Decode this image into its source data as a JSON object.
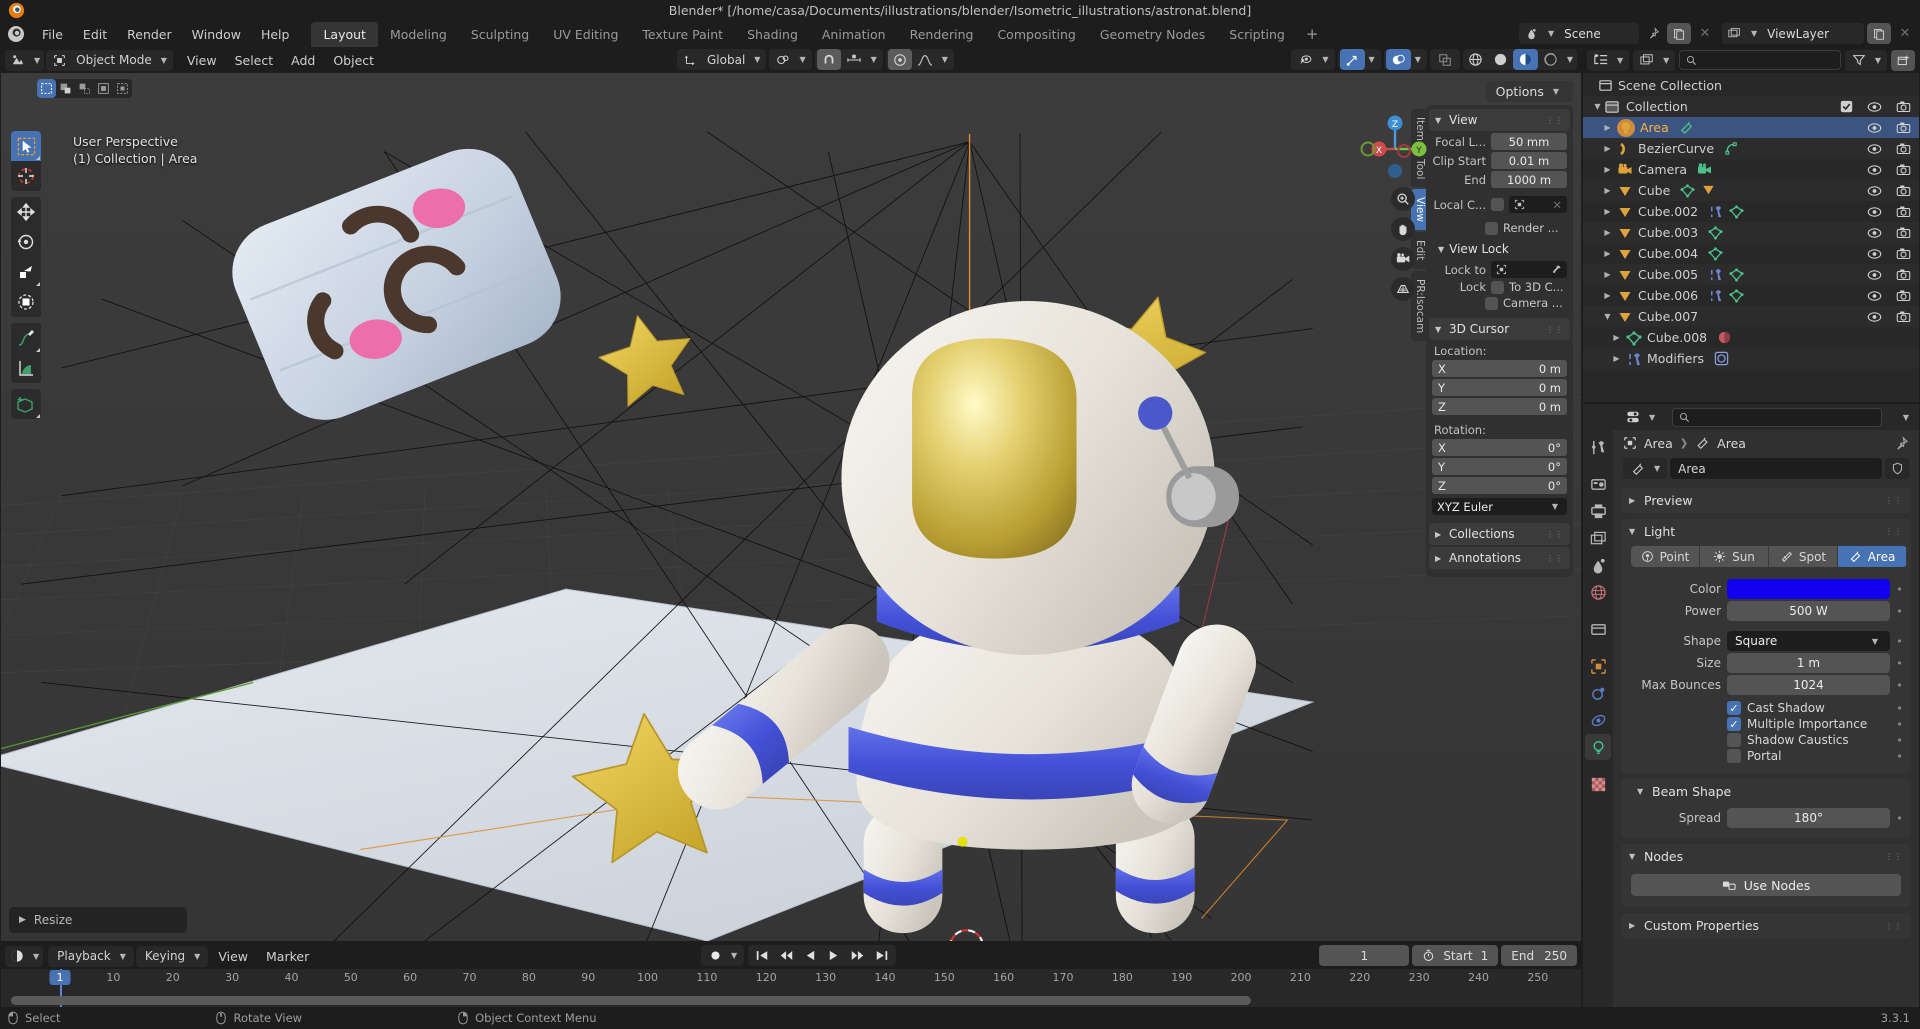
{
  "window": {
    "title": "Blender* [/home/casa/Documents/illustrations/blender/Isometric_illustrations/astronat.blend]"
  },
  "menubar": {
    "items": [
      "File",
      "Edit",
      "Render",
      "Window",
      "Help"
    ],
    "workspaces": [
      "Layout",
      "Modeling",
      "Sculpting",
      "UV Editing",
      "Texture Paint",
      "Shading",
      "Animation",
      "Rendering",
      "Compositing",
      "Geometry Nodes",
      "Scripting"
    ],
    "active_workspace": "Layout",
    "add_workspace": "+",
    "scene_name": "Scene",
    "viewlayer_name": "ViewLayer"
  },
  "viewport": {
    "mode": "Object Mode",
    "menus": [
      "View",
      "Select",
      "Add",
      "Object"
    ],
    "transform_orientation": "Global",
    "overlay_text_line1": "User Perspective",
    "overlay_text_line2": "(1) Collection | Area",
    "options_label": "Options",
    "operator_panel": "Resize",
    "gizmo_axes": {
      "x": "X",
      "y": "Y",
      "z": "Z"
    },
    "tools": [
      "tweak-select-tool",
      "cursor-tool",
      "move-tool",
      "rotate-tool",
      "scale-tool",
      "transform-tool",
      "annotate-tool",
      "measure-tool",
      "add-cube-tool"
    ]
  },
  "npanel": {
    "tabs": [
      "Item",
      "Tool",
      "View",
      "Edit",
      "PR:Isocam"
    ],
    "active_tab": "View",
    "view": {
      "title": "View",
      "rows": [
        {
          "label": "Focal L...",
          "value": "50 mm"
        },
        {
          "label": "Clip Start",
          "value": "0.01 m"
        },
        {
          "label": "End",
          "value": "1000 m"
        }
      ],
      "local_camera_label": "Local C...",
      "render_label": "Render ...",
      "view_lock_title": "View Lock",
      "lock_to_label": "Lock to",
      "lock_label": "Lock",
      "to_3d_cursor_label": "To 3D C...",
      "camera_label": "Camera ..."
    },
    "cursor": {
      "title": "3D Cursor",
      "location_label": "Location:",
      "location": [
        {
          "axis": "X",
          "value": "0 m"
        },
        {
          "axis": "Y",
          "value": "0 m"
        },
        {
          "axis": "Z",
          "value": "0 m"
        }
      ],
      "rotation_label": "Rotation:",
      "rotation": [
        {
          "axis": "X",
          "value": "0°"
        },
        {
          "axis": "Y",
          "value": "0°"
        },
        {
          "axis": "Z",
          "value": "0°"
        }
      ],
      "rotation_mode": "XYZ Euler"
    },
    "collections_title": "Collections",
    "annotations_title": "Annotations"
  },
  "outliner": {
    "scene_collection": "Scene Collection",
    "collection": "Collection",
    "items": [
      {
        "name": "Area",
        "indent": 2,
        "type": "light",
        "selected": true,
        "expanded": false,
        "data_icons": [
          "area-light-data-icon"
        ]
      },
      {
        "name": "BezierCurve",
        "indent": 2,
        "type": "curve",
        "selected": false,
        "expanded": false,
        "data_icons": [
          "curve-data-icon"
        ]
      },
      {
        "name": "Camera",
        "indent": 2,
        "type": "camera",
        "selected": false,
        "expanded": false,
        "data_icons": [
          "camera-data-icon"
        ]
      },
      {
        "name": "Cube",
        "indent": 2,
        "type": "mesh",
        "selected": false,
        "expanded": false,
        "data_icons": [
          "mesh-data-icon",
          "mesh-users-2-icon"
        ]
      },
      {
        "name": "Cube.002",
        "indent": 2,
        "type": "mesh",
        "selected": false,
        "expanded": false,
        "data_icons": [
          "modifier-icon",
          "mesh-data-icon"
        ]
      },
      {
        "name": "Cube.003",
        "indent": 2,
        "type": "mesh",
        "selected": false,
        "expanded": false,
        "data_icons": [
          "mesh-data-icon"
        ]
      },
      {
        "name": "Cube.004",
        "indent": 2,
        "type": "mesh",
        "selected": false,
        "expanded": false,
        "data_icons": [
          "mesh-data-icon"
        ]
      },
      {
        "name": "Cube.005",
        "indent": 2,
        "type": "mesh",
        "selected": false,
        "expanded": false,
        "data_icons": [
          "modifier-icon",
          "mesh-data-icon"
        ]
      },
      {
        "name": "Cube.006",
        "indent": 2,
        "type": "mesh",
        "selected": false,
        "expanded": false,
        "data_icons": [
          "modifier-icon",
          "mesh-data-icon"
        ]
      },
      {
        "name": "Cube.007",
        "indent": 2,
        "type": "mesh",
        "selected": false,
        "expanded": true,
        "data_icons": []
      },
      {
        "name": "Cube.008",
        "indent": 3,
        "type": "meshdata",
        "selected": false,
        "expanded": false,
        "data_icons": [
          "material-icon"
        ],
        "no_vis": true
      },
      {
        "name": "Modifiers",
        "indent": 3,
        "type": "modifier",
        "selected": false,
        "expanded": false,
        "data_icons": [
          "subsurf-modifier-icon"
        ],
        "no_vis": true
      }
    ]
  },
  "properties": {
    "breadcrumb": [
      "Area",
      "Area"
    ],
    "id_name": "Area",
    "preview_title": "Preview",
    "light_title": "Light",
    "light_types": [
      "Point",
      "Sun",
      "Spot",
      "Area"
    ],
    "active_light_type": "Area",
    "rows": [
      {
        "label": "Color",
        "value": "",
        "kind": "color",
        "color": "#1100ee"
      },
      {
        "label": "Power",
        "value": "500 W",
        "kind": "value"
      },
      {
        "label": "Shape",
        "value": "Square",
        "kind": "select"
      },
      {
        "label": "Size",
        "value": "1 m",
        "kind": "value"
      },
      {
        "label": "Max Bounces",
        "value": "1024",
        "kind": "value"
      }
    ],
    "checks": [
      {
        "label": "Cast Shadow",
        "checked": true
      },
      {
        "label": "Multiple Importance",
        "checked": true
      },
      {
        "label": "Shadow Caustics",
        "checked": false
      },
      {
        "label": "Portal",
        "checked": false
      }
    ],
    "beam_shape_title": "Beam Shape",
    "spread_label": "Spread",
    "spread_value": "180°",
    "nodes_title": "Nodes",
    "use_nodes_label": "Use Nodes",
    "custom_properties_title": "Custom Properties",
    "tabs": [
      "tool-icon",
      "render-icon",
      "output-icon",
      "view-layer-icon",
      "scene-icon",
      "world-icon",
      "collection-icon",
      "object-icon",
      "modifier-physics-icon",
      "constraints-icon",
      "light-data-icon",
      "texture-icon"
    ],
    "active_tab": "light-data-icon"
  },
  "timeline": {
    "menus": [
      "Playback",
      "Keying",
      "View",
      "Marker"
    ],
    "current_frame": "1",
    "start_label": "Start",
    "start_value": "1",
    "end_label": "End",
    "end_value": "250",
    "ticks": [
      10,
      20,
      30,
      40,
      50,
      60,
      70,
      80,
      90,
      100,
      110,
      120,
      130,
      140,
      150,
      160,
      170,
      180,
      190,
      200,
      210,
      220,
      230,
      240,
      250
    ],
    "playhead_frame": 1
  },
  "statusbar": {
    "items": [
      {
        "label": "Select",
        "icon": "mouse-left-icon"
      },
      {
        "label": "Rotate View",
        "icon": "mouse-middle-icon"
      },
      {
        "label": "Object Context Menu",
        "icon": "mouse-right-icon"
      }
    ],
    "version": "3.3.1"
  }
}
